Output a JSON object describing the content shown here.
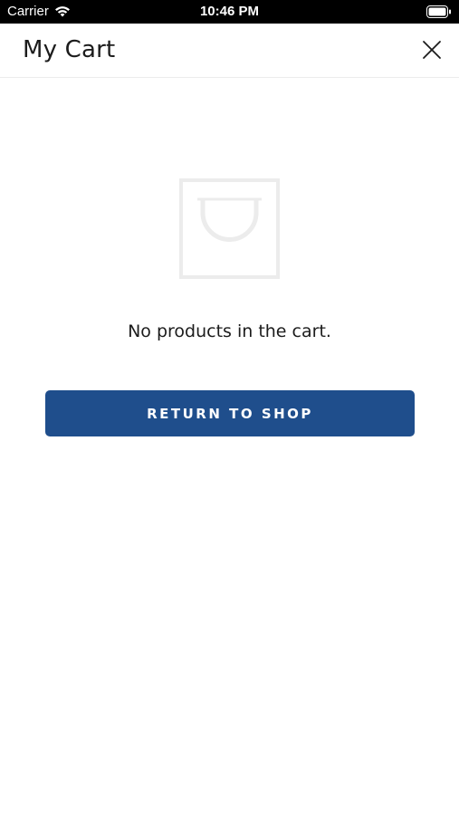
{
  "status_bar": {
    "carrier": "Carrier",
    "time": "10:46 PM",
    "wifi_icon": "wifi-icon",
    "battery_icon": "battery-icon"
  },
  "header": {
    "title": "My Cart",
    "close_icon": "close-icon"
  },
  "cart": {
    "empty_icon": "shopping-bag-icon",
    "empty_message": "No products in the cart.",
    "return_button_label": "RETURN TO SHOP"
  },
  "colors": {
    "accent": "#1f4e8c",
    "text": "#1c1c1c",
    "icon_gray": "#ececec"
  }
}
